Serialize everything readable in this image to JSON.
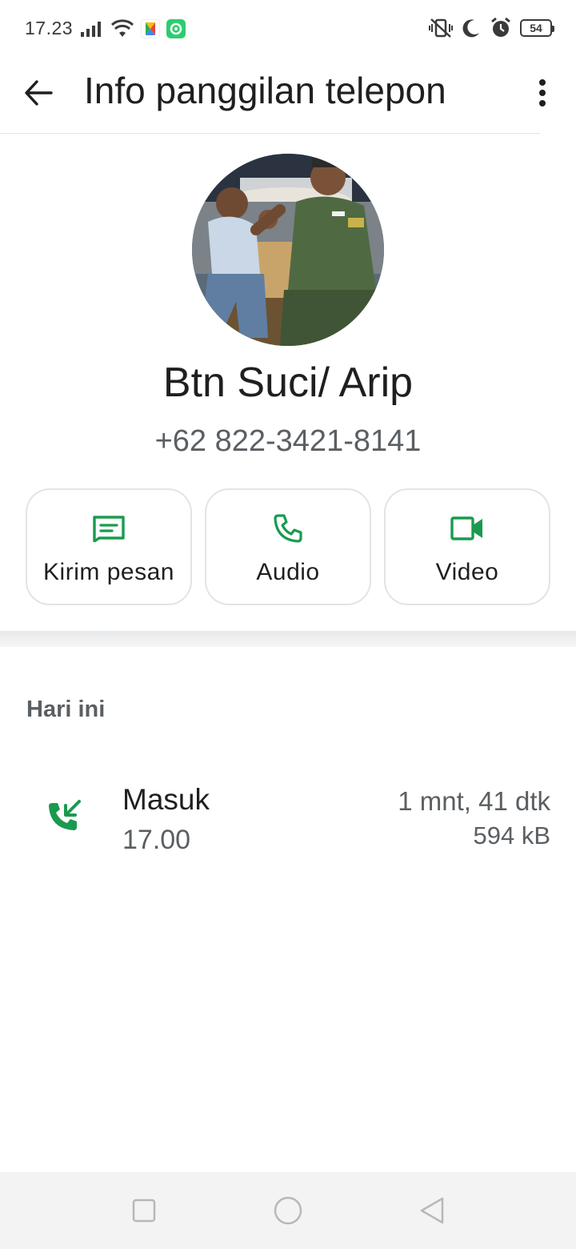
{
  "status_bar": {
    "time": "17.23",
    "battery": "54",
    "icons_left": [
      "signal-icon",
      "wifi-icon",
      "photos-app-icon",
      "game-app-icon"
    ],
    "icons_right": [
      "vibrate-off-icon",
      "do-not-disturb-moon-icon",
      "alarm-icon",
      "battery-icon"
    ]
  },
  "app_bar": {
    "title": "Info panggilan telepon",
    "back_icon": "arrow-back-icon",
    "menu_icon": "more-vert-icon"
  },
  "contact": {
    "name": "Btn Suci/ Arip",
    "phone": "+62 822-3421-8141"
  },
  "actions": [
    {
      "label": "Kirim pesan",
      "icon": "message-icon"
    },
    {
      "label": "Audio",
      "icon": "phone-icon"
    },
    {
      "label": "Video",
      "icon": "videocam-icon"
    }
  ],
  "call_log": {
    "section": "Hari ini",
    "entries": [
      {
        "type": "Masuk",
        "time": "17.00",
        "duration": "1 mnt, 41 dtk",
        "size": "594 kB",
        "icon": "incoming-call-icon"
      }
    ]
  },
  "nav_bar": {
    "buttons": [
      "recent-apps-icon",
      "home-icon",
      "back-nav-icon"
    ]
  },
  "colors": {
    "accent_green": "#1a9a4f",
    "text_primary": "#1f1f1f",
    "text_secondary": "#5a5f63"
  }
}
